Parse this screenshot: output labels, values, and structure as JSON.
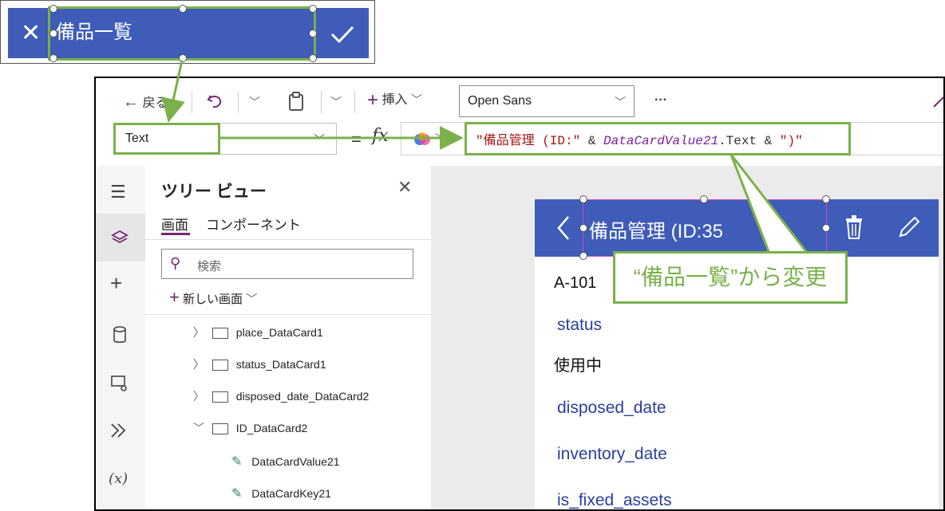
{
  "inset": {
    "close_icon": "close-icon",
    "confirm_icon": "check-icon",
    "title_label": "備品一覧"
  },
  "toolbar": {
    "back_label": "戻る",
    "insert_label": "挿入",
    "font_value": "Open Sans",
    "more_label": "···"
  },
  "formula_bar": {
    "property_value": "Text",
    "equals": "=",
    "fx": "fx",
    "formula": {
      "part1": "\"備品管理 (ID:\"",
      "op1": " & ",
      "part2": "DataCardValue21",
      "part3": ".Text",
      "op2": " & ",
      "part4": "\")\""
    }
  },
  "tree_view": {
    "title": "ツリー ビュー",
    "tabs": [
      "画面",
      "コンポーネント"
    ],
    "search_placeholder": "検索",
    "new_screen_label": "新しい画面",
    "items": [
      {
        "label": "place_DataCard1"
      },
      {
        "label": "status_DataCard1"
      },
      {
        "label": "disposed_date_DataCard2"
      },
      {
        "label": "ID_DataCard2"
      },
      {
        "label": "DataCardValue21"
      },
      {
        "label": "DataCardKey21"
      }
    ]
  },
  "canvas": {
    "header_title": "備品管理 (ID:35)",
    "header_title_visible": "備品管理 (ID:35",
    "value_a101": "A-101",
    "fields": [
      {
        "label": "status",
        "value": "使用中"
      },
      {
        "label": "disposed_date",
        "value": ""
      },
      {
        "label": "inventory_date",
        "value": ""
      },
      {
        "label": "is_fixed_assets",
        "value": ""
      }
    ]
  },
  "callout": {
    "text": "“備品一覧”から変更"
  },
  "colors": {
    "accent_green": "#7bb14a",
    "header_blue": "#3e5cb8",
    "formula_string": "#a31515",
    "formula_identifier": "#7a1ea1",
    "purple_accent": "#742774"
  }
}
